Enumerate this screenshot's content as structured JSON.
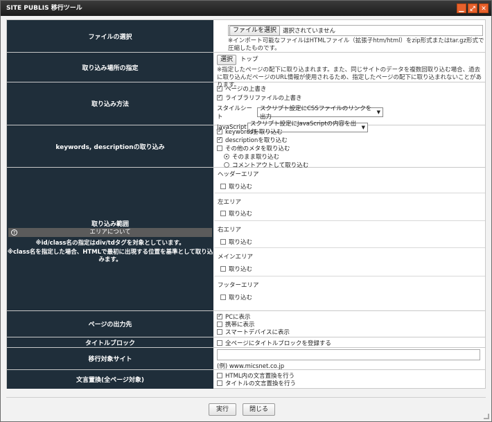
{
  "window": {
    "title": "SITE PUBLIS 移行ツール",
    "controls": [
      "minimize-icon",
      "maximize-icon",
      "close-icon"
    ],
    "accent_color": "#e8612c"
  },
  "file_select": {
    "label": "ファイルの選択",
    "button": "ファイルを選択",
    "status": "選択されていません",
    "note": "※インポート可能なファイルはHTMLファイル（拡張子htm/html）をzip形式またはtar.gz形式で圧縮したものです。"
  },
  "import_location": {
    "label": "取り込み場所の指定",
    "button": "選択",
    "value": "トップ",
    "note": "※指定したページの配下に取り込まれます。また、同じサイトのデータを複数回取り込む場合、過去に取り込んだページのURL情報が使用されるため、指定したページの配下に取り込まれないことがあります。"
  },
  "import_method": {
    "label": "取り込み方法",
    "overwrite_page": "ページの上書き",
    "overwrite_library": "ライブラリファイルの上書き",
    "stylesheet_label": "スタイルシート",
    "stylesheet_value": "スクリプト設定にCSSファイルのリンクを出力",
    "javascript_label": "JavaScript",
    "javascript_value": "スクリプト設定にJavaScriptの内容を出力"
  },
  "meta_import": {
    "label": "keywords, descriptionの取り込み",
    "keywords": "keywordsを取り込む",
    "description": "descriptionを取り込む",
    "other_meta": "その他のメタを取り込む",
    "as_is": "そのまま取り込む",
    "comment_out": "コメントアウトして取り込む"
  },
  "import_range": {
    "label": "取り込み範囲",
    "about_title": "エリアについて",
    "about_note_1": "※id/class名の指定はdiv/tdタグを対象としています。",
    "about_note_2": "※class名を指定した場合、HTMLで最初に出現する位置を基準として取り込みます。",
    "import_label": "取り込む",
    "areas": [
      "ヘッダーエリア",
      "左エリア",
      "右エリア",
      "メインエリア",
      "フッターエリア"
    ]
  },
  "output_target": {
    "label": "ページの出力先",
    "pc": "PCに表示",
    "mobile": "携帯に表示",
    "smart": "スマートデバイスに表示"
  },
  "title_block": {
    "label": "タイトルブロック",
    "option": "全ページにタイトルブロックを登録する"
  },
  "target_site": {
    "label": "移行対象サイト",
    "value": "",
    "example": "(例) www.micsnet.co.jp"
  },
  "text_replace": {
    "label": "文言置換(全ページ対象)",
    "html": "HTML内の文言置換を行う",
    "title": "タイトルの文言置換を行う"
  },
  "footer": {
    "run": "実行",
    "close": "閉じる"
  }
}
